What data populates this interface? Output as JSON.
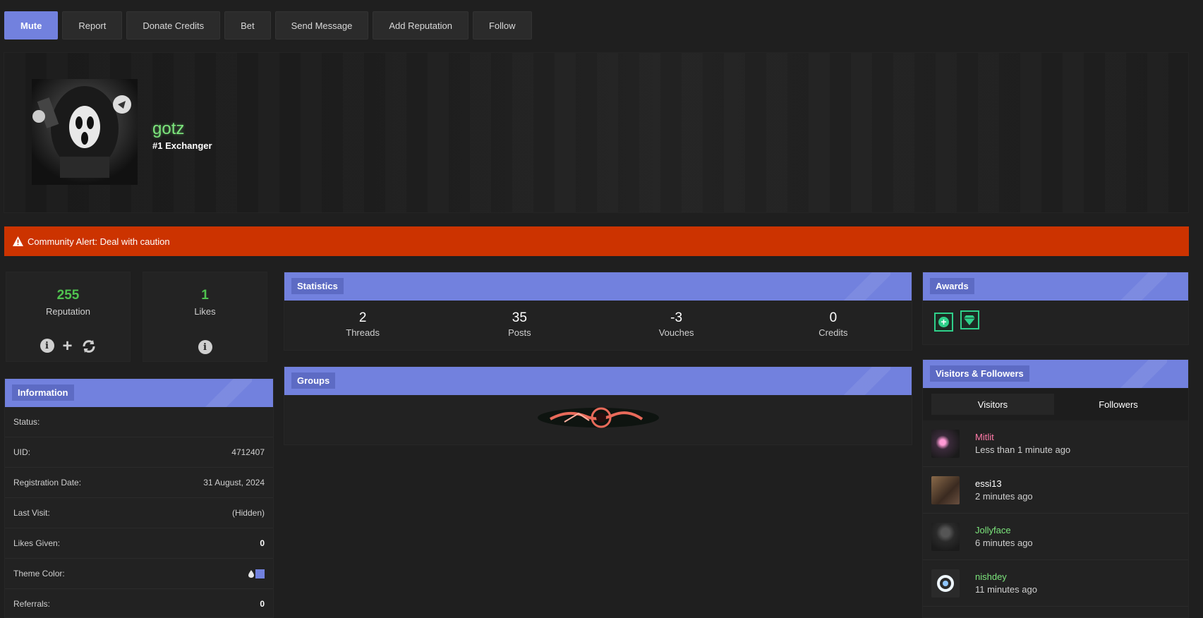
{
  "actions": {
    "mute": "Mute",
    "report": "Report",
    "donate": "Donate Credits",
    "bet": "Bet",
    "send_message": "Send Message",
    "add_reputation": "Add Reputation",
    "follow": "Follow"
  },
  "profile": {
    "username": "gotz",
    "title": "#1 Exchanger"
  },
  "alert": {
    "icon": "warning-icon",
    "text": "Community Alert: Deal with caution"
  },
  "reputation": {
    "value": "255",
    "label": "Reputation"
  },
  "likes": {
    "value": "1",
    "label": "Likes"
  },
  "information": {
    "title": "Information",
    "rows": [
      {
        "label": "Status:",
        "value": ""
      },
      {
        "label": "UID:",
        "value": "4712407"
      },
      {
        "label": "Registration Date:",
        "value": "31 August, 2024"
      },
      {
        "label": "Last Visit:",
        "value": "(Hidden)"
      },
      {
        "label": "Likes Given:",
        "value": "0"
      },
      {
        "label": "Theme Color:",
        "value": ""
      },
      {
        "label": "Referrals:",
        "value": "0"
      }
    ]
  },
  "statistics": {
    "title": "Statistics",
    "items": [
      {
        "value": "2",
        "label": "Threads"
      },
      {
        "value": "35",
        "label": "Posts"
      },
      {
        "value": "-3",
        "label": "Vouches"
      },
      {
        "value": "0",
        "label": "Credits"
      }
    ]
  },
  "groups": {
    "title": "Groups"
  },
  "awards": {
    "title": "Awards",
    "badges": [
      "plus-badge-icon",
      "diamond-badge-icon"
    ]
  },
  "visitors": {
    "title": "Visitors & Followers",
    "tabs": [
      "Visitors",
      "Followers"
    ],
    "list": [
      {
        "name": "Mitlit",
        "time": "Less than 1 minute ago",
        "color": "#ff7aa8"
      },
      {
        "name": "essi13",
        "time": "2 minutes ago",
        "color": "#ffffff"
      },
      {
        "name": "Jollyface",
        "time": "6 minutes ago",
        "color": "#7ce57c"
      },
      {
        "name": "nishdey",
        "time": "11 minutes ago",
        "color": "#7ce57c"
      }
    ]
  },
  "colors": {
    "accent": "#7281de",
    "alert": "#cc3300",
    "positive": "#4fc24f"
  }
}
